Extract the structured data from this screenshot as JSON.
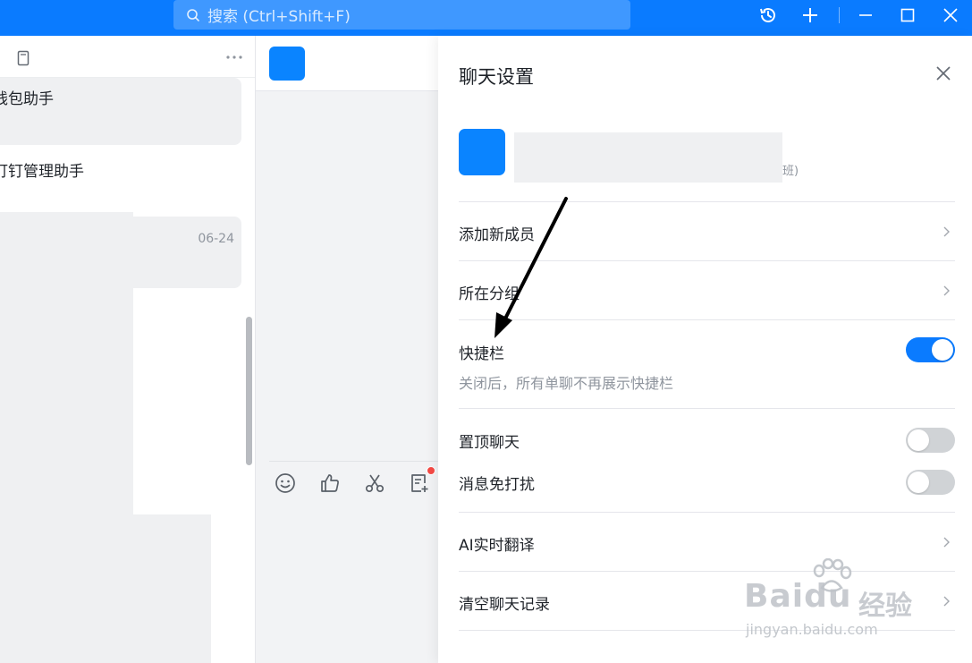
{
  "topbar": {
    "search_placeholder": "搜索 (Ctrl+Shift+F)",
    "icons": [
      "search-icon",
      "history-icon",
      "plus-icon",
      "minimize-icon",
      "maximize-icon",
      "close-icon"
    ]
  },
  "conversation_list": {
    "items": [
      {
        "title": "钱包助手",
        "date": ""
      },
      {
        "title": "钉钉管理助手",
        "date": ""
      },
      {
        "title": "",
        "date": "06-24"
      }
    ]
  },
  "chat": {
    "toolbar_icons": [
      "emoji-icon",
      "thumbs-up-icon",
      "scissors-icon",
      "note-add-icon"
    ]
  },
  "settings": {
    "title": "聊天设置",
    "group_suffix": "班)",
    "add_member_label": "添加新成员",
    "group_label": "所在分组",
    "shortcut_bar_label": "快捷栏",
    "shortcut_bar_desc": "关闭后，所有单聊不再展示快捷栏",
    "shortcut_bar_on": true,
    "pin_chat_label": "置顶聊天",
    "pin_chat_on": false,
    "mute_label": "消息免打扰",
    "mute_on": false,
    "ai_translate_label": "AI实时翻译",
    "clear_history_label": "清空聊天记录"
  },
  "watermark": {
    "main": "Baidu",
    "cn": "经验",
    "sub": "jingyan.baidu.com"
  },
  "colors": {
    "brand_blue": "#0a7bff",
    "toggle_off": "#d0d3d6",
    "notification_red": "#f54a45"
  }
}
